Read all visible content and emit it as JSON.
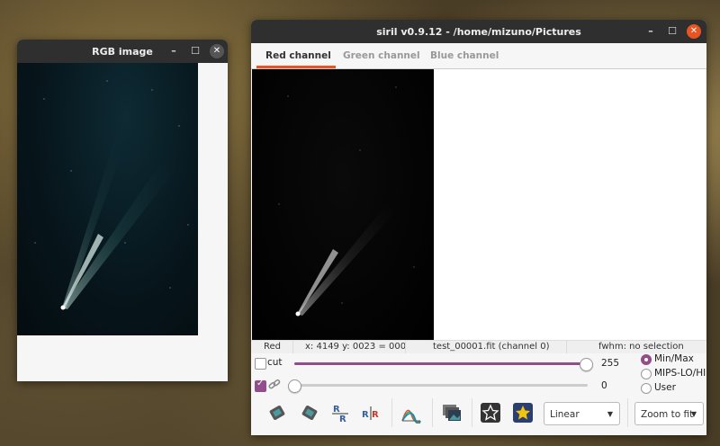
{
  "rgb_window": {
    "title": "RGB image"
  },
  "main_window": {
    "title": "siril v0.9.12 - /home/mizuno/Pictures"
  },
  "tabs": [
    {
      "label": "Red channel"
    },
    {
      "label": "Green channel"
    },
    {
      "label": "Blue channel"
    }
  ],
  "status": {
    "channel": "Red",
    "coords": "x: 4149 y: 0023 = 000",
    "file": "test_00001.fit (channel 0)",
    "fwhm": "fwhm: no selection"
  },
  "controls": {
    "cut_label": "cut",
    "upper_value": "255",
    "lower_value": "0",
    "upper_slider_fraction": 1.0,
    "lower_slider_fraction": 0.0,
    "range_options": [
      {
        "label": "Min/Max",
        "selected": true
      },
      {
        "label": "MIPS-LO/HI",
        "selected": false
      },
      {
        "label": "User",
        "selected": false
      }
    ],
    "scale_select": "Linear",
    "zoom_select": "Zoom to fit"
  },
  "colors": {
    "accent": "#924d8b",
    "tab_underline": "#e95420",
    "close_button": "#e95420"
  }
}
